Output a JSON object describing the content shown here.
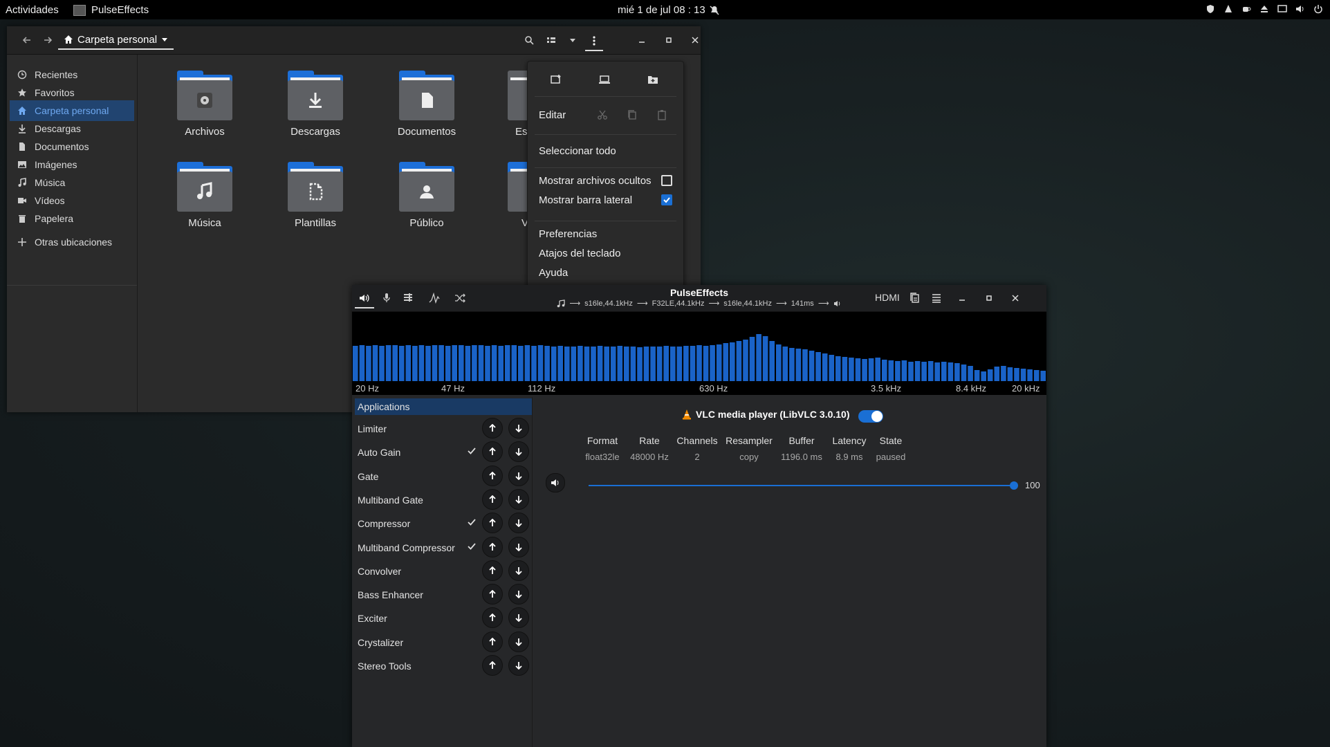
{
  "topbar": {
    "activities": "Actividades",
    "app_name": "PulseEffects",
    "clock": "mié  1 de jul  08 : 13"
  },
  "nautilus": {
    "path": "Carpeta personal",
    "sidebar": [
      {
        "label": "Recientes",
        "icon": "clock-icon"
      },
      {
        "label": "Favoritos",
        "icon": "star-icon"
      },
      {
        "label": "Carpeta personal",
        "icon": "home-icon",
        "active": true
      },
      {
        "label": "Descargas",
        "icon": "download-icon"
      },
      {
        "label": "Documentos",
        "icon": "document-icon"
      },
      {
        "label": "Imágenes",
        "icon": "image-icon"
      },
      {
        "label": "Música",
        "icon": "music-icon"
      },
      {
        "label": "Vídeos",
        "icon": "video-icon"
      },
      {
        "label": "Papelera",
        "icon": "trash-icon"
      },
      {
        "label": "Otras ubicaciones",
        "icon": "plus-icon"
      }
    ],
    "folders": [
      {
        "label": "Archivos",
        "icon": "disk-icon"
      },
      {
        "label": "Descargas",
        "icon": "download-icon"
      },
      {
        "label": "Documentos",
        "icon": "document-icon"
      },
      {
        "label": "Escr",
        "icon": "desktop-icon"
      },
      {
        "label": "Música",
        "icon": "music-icon"
      },
      {
        "label": "Plantillas",
        "icon": "template-icon"
      },
      {
        "label": "Público",
        "icon": "user-icon"
      },
      {
        "label": "Víd",
        "icon": "video-icon"
      }
    ]
  },
  "menu": {
    "edit": "Editar",
    "select_all": "Seleccionar todo",
    "show_hidden": "Mostrar archivos ocultos",
    "show_hidden_checked": false,
    "show_sidebar": "Mostrar barra lateral",
    "show_sidebar_checked": true,
    "preferences": "Preferencias",
    "shortcuts": "Atajos del teclado",
    "help": "Ayuda"
  },
  "pulseeffects": {
    "title": "PulseEffects",
    "pipeline": [
      "s16le,44.1kHz",
      "F32LE,44.1kHz",
      "s16le,44.1kHz",
      "141ms"
    ],
    "output_device": "HDMI",
    "spectrum_levels": [
      0.51,
      0.52,
      0.51,
      0.52,
      0.51,
      0.52,
      0.52,
      0.51,
      0.52,
      0.51,
      0.52,
      0.51,
      0.52,
      0.52,
      0.51,
      0.52,
      0.52,
      0.51,
      0.52,
      0.52,
      0.51,
      0.52,
      0.51,
      0.52,
      0.52,
      0.51,
      0.52,
      0.51,
      0.52,
      0.51,
      0.5,
      0.51,
      0.5,
      0.5,
      0.51,
      0.5,
      0.5,
      0.51,
      0.5,
      0.5,
      0.51,
      0.5,
      0.5,
      0.49,
      0.5,
      0.5,
      0.5,
      0.51,
      0.5,
      0.5,
      0.51,
      0.51,
      0.52,
      0.51,
      0.52,
      0.53,
      0.55,
      0.56,
      0.58,
      0.6,
      0.64,
      0.68,
      0.65,
      0.58,
      0.53,
      0.5,
      0.48,
      0.47,
      0.46,
      0.44,
      0.42,
      0.4,
      0.38,
      0.36,
      0.35,
      0.34,
      0.33,
      0.32,
      0.33,
      0.34,
      0.31,
      0.3,
      0.29,
      0.3,
      0.28,
      0.29,
      0.28,
      0.29,
      0.27,
      0.28,
      0.27,
      0.26,
      0.24,
      0.22,
      0.16,
      0.14,
      0.17,
      0.21,
      0.22,
      0.2,
      0.19,
      0.18,
      0.17,
      0.16,
      0.15
    ],
    "freq_labels": [
      "20 Hz",
      "47 Hz",
      "112 Hz",
      "630 Hz",
      "3.5 kHz",
      "8.4 kHz",
      "20 kHz"
    ],
    "plugins_header": "Applications",
    "plugins": [
      {
        "label": "Limiter",
        "enabled": false
      },
      {
        "label": "Auto Gain",
        "enabled": true
      },
      {
        "label": "Gate",
        "enabled": false
      },
      {
        "label": "Multiband Gate",
        "enabled": false
      },
      {
        "label": "Compressor",
        "enabled": true
      },
      {
        "label": "Multiband Compressor",
        "enabled": true
      },
      {
        "label": "Convolver",
        "enabled": false
      },
      {
        "label": "Bass Enhancer",
        "enabled": false
      },
      {
        "label": "Exciter",
        "enabled": false
      },
      {
        "label": "Crystalizer",
        "enabled": false
      },
      {
        "label": "Stereo Tools",
        "enabled": false
      }
    ],
    "app": {
      "name": "VLC media player (LibVLC 3.0.10)",
      "enabled": true,
      "stats": [
        {
          "label": "Format",
          "value": "float32le"
        },
        {
          "label": "Rate",
          "value": "48000 Hz"
        },
        {
          "label": "Channels",
          "value": "2"
        },
        {
          "label": "Resampler",
          "value": "copy"
        },
        {
          "label": "Buffer",
          "value": "1196.0 ms"
        },
        {
          "label": "Latency",
          "value": "8.9 ms"
        },
        {
          "label": "State",
          "value": "paused"
        }
      ],
      "volume": "100"
    }
  },
  "colors": {
    "accent": "#1a6fd4",
    "folder": "#1d6fd8",
    "spectrum_bar": "#1a63c8"
  }
}
